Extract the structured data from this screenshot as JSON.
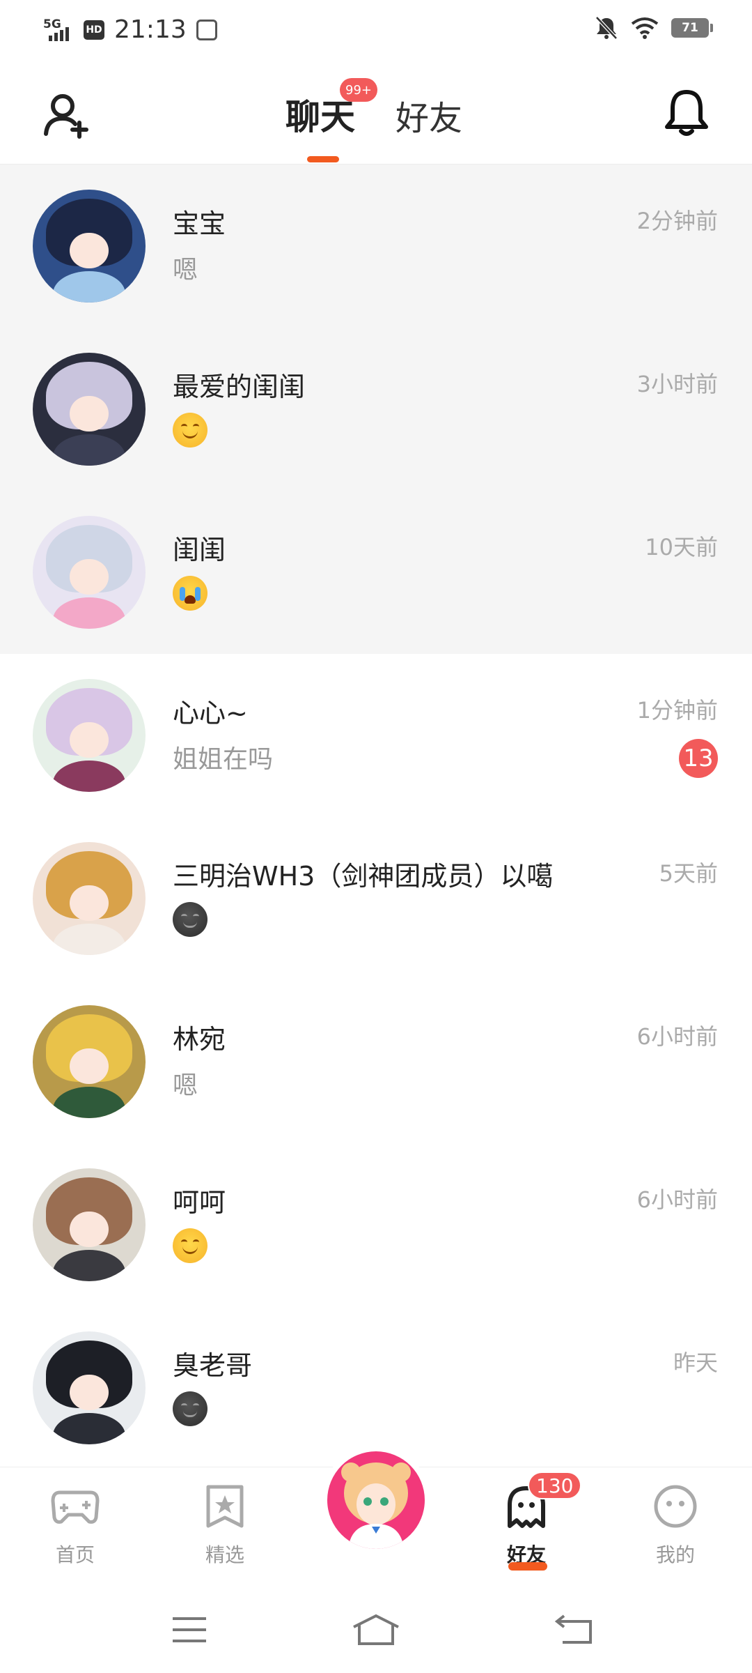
{
  "status_bar": {
    "network": "5G",
    "hd": "HD",
    "time": "21:13",
    "battery": "71"
  },
  "header": {
    "tabs": [
      {
        "label": "聊天",
        "active": true,
        "badge": "99+"
      },
      {
        "label": "好友",
        "active": false
      }
    ]
  },
  "chats": [
    {
      "name": "宝宝",
      "message": "嗯",
      "time": "2分钟前",
      "pinned": true,
      "emoji": null,
      "unread": null,
      "colors": {
        "bg": "#2f4f8a",
        "hair": "#1c2746",
        "body": "#9fc7ea"
      }
    },
    {
      "name": "最爱的闺闺",
      "message": "",
      "time": "3小时前",
      "pinned": true,
      "emoji": "smile",
      "unread": null,
      "colors": {
        "bg": "#2b2e3e",
        "hair": "#c9c4dd",
        "body": "#3b3f55"
      }
    },
    {
      "name": "闺闺",
      "message": "",
      "time": "10天前",
      "pinned": true,
      "emoji": "cry",
      "unread": null,
      "colors": {
        "bg": "#e8e4f2",
        "hair": "#cfd6e6",
        "body": "#f3a8c8"
      }
    },
    {
      "name": "心心~",
      "message": "姐姐在吗",
      "time": "1分钟前",
      "pinned": false,
      "emoji": null,
      "unread": "13",
      "colors": {
        "bg": "#e6f0e8",
        "hair": "#d9c6e6",
        "body": "#8a3a5e"
      }
    },
    {
      "name": "三明治WH3（剑神团成员）以噶",
      "message": "",
      "time": "5天前",
      "pinned": false,
      "emoji": "moon",
      "unread": null,
      "colors": {
        "bg": "#f1e1d6",
        "hair": "#d9a24a",
        "body": "#f3ece6"
      }
    },
    {
      "name": "林宛",
      "message": "嗯",
      "time": "6小时前",
      "pinned": false,
      "emoji": null,
      "unread": null,
      "colors": {
        "bg": "#b89a4a",
        "hair": "#e9c24a",
        "body": "#2f5a3a"
      }
    },
    {
      "name": "呵呵",
      "message": "",
      "time": "6小时前",
      "pinned": false,
      "emoji": "smile",
      "unread": null,
      "colors": {
        "bg": "#ddd9d0",
        "hair": "#9a6e52",
        "body": "#3a3a40"
      }
    },
    {
      "name": "臭老哥",
      "message": "",
      "time": "昨天",
      "pinned": false,
      "emoji": "moon",
      "unread": null,
      "colors": {
        "bg": "#e9ecef",
        "hair": "#1d1f26",
        "body": "#2a2d36"
      }
    }
  ],
  "bottom_nav": {
    "items": [
      {
        "label": "首页",
        "icon": "gamepad-icon",
        "active": false
      },
      {
        "label": "精选",
        "icon": "featured-star-icon",
        "active": false
      },
      {
        "label": "好友",
        "icon": "ghost-icon",
        "active": true,
        "badge": "130"
      },
      {
        "label": "我的",
        "icon": "smiley-face-icon",
        "active": false
      }
    ],
    "center_icon": "profile-avatar-button"
  },
  "accent_color": "#f25a1f",
  "badge_color": "#f25a5a"
}
